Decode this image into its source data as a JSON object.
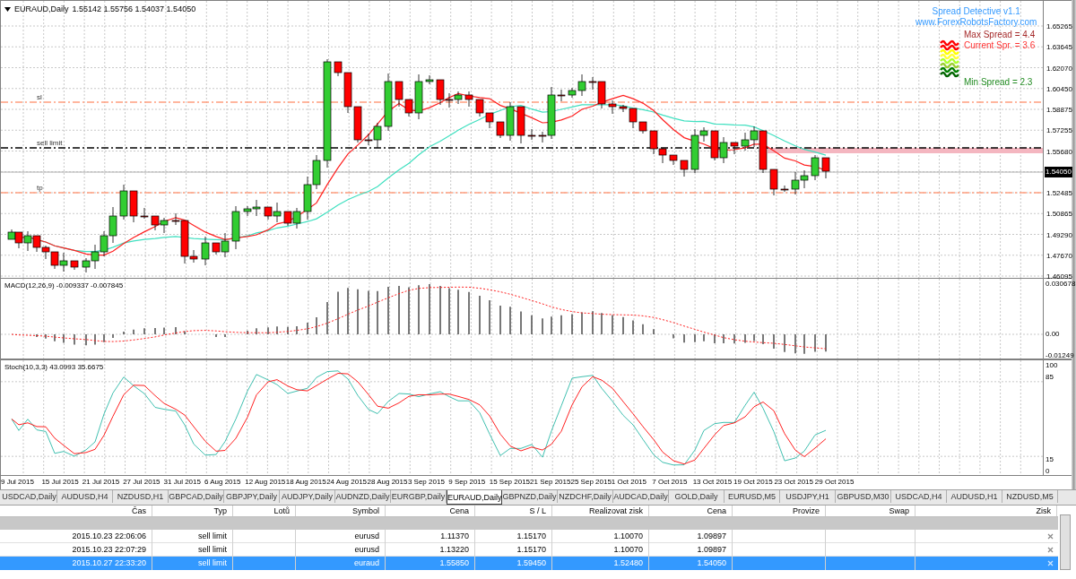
{
  "chart_header": {
    "symbol": "EURAUD,Daily",
    "ohlc": "1.55142 1.55756 1.54037 1.54050"
  },
  "order_lines": [
    {
      "kind": "sl",
      "label": "sl"
    },
    {
      "kind": "entry",
      "label": "sell limit"
    },
    {
      "kind": "tp",
      "label": "tp"
    }
  ],
  "spread_detective": {
    "title": "Spread Detective v1.1",
    "website": "www.ForexRobotsFactory.com",
    "max": "Max Spread = 4.4",
    "current": "Current Spr. = 3.6",
    "min": "Min Spread = 2.3"
  },
  "price_axis": [
    {
      "label": "1.65265",
      "kind": "tick"
    },
    {
      "label": "1.63645",
      "kind": "tick"
    },
    {
      "label": "1.62070",
      "kind": "tick"
    },
    {
      "label": "1.60450",
      "kind": "tick"
    },
    {
      "label": "1.58875",
      "kind": "tick"
    },
    {
      "label": "1.57255",
      "kind": "tick"
    },
    {
      "label": "1.55680",
      "kind": "tick"
    },
    {
      "label": "1.54050",
      "kind": "current"
    },
    {
      "label": "1.52485",
      "kind": "tick"
    },
    {
      "label": "1.50865",
      "kind": "tick"
    },
    {
      "label": "1.49290",
      "kind": "tick"
    },
    {
      "label": "1.47670",
      "kind": "tick"
    },
    {
      "label": "1.46095",
      "kind": "tick"
    }
  ],
  "macd": {
    "label": "MACD(12,26,9) -0.009337 -0.007845",
    "axis": [
      "0.030678",
      "0.00",
      "-0.01249"
    ]
  },
  "stoch": {
    "label": "Stoch(10,3,3) 43.0993 35.6675",
    "axis": [
      "100",
      "85",
      "15",
      "0"
    ]
  },
  "dates": [
    "9 Jul 2015",
    "15 Jul 2015",
    "21 Jul 2015",
    "27 Jul 2015",
    "31 Jul 2015",
    "6 Aug 2015",
    "12 Aug 2015",
    "18 Aug 2015",
    "24 Aug 2015",
    "28 Aug 2015",
    "3 Sep 2015",
    "9 Sep 2015",
    "15 Sep 2015",
    "21 Sep 2015",
    "25 Sep 2015",
    "1 Oct 2015",
    "7 Oct 2015",
    "13 Oct 2015",
    "19 Oct 2015",
    "23 Oct 2015",
    "29 Oct 2015"
  ],
  "tabs": [
    {
      "label": "USDCAD,Daily",
      "selected": false
    },
    {
      "label": "AUDUSD,H4",
      "selected": false
    },
    {
      "label": "NZDUSD,H1",
      "selected": false
    },
    {
      "label": "GBPCAD,Daily",
      "selected": false
    },
    {
      "label": "GBPJPY,Daily",
      "selected": false
    },
    {
      "label": "AUDJPY,Daily",
      "selected": false
    },
    {
      "label": "AUDNZD,Daily",
      "selected": false
    },
    {
      "label": "EURGBP,Daily",
      "selected": false
    },
    {
      "label": "EURAUD,Daily",
      "selected": true
    },
    {
      "label": "GBPNZD,Daily",
      "selected": false
    },
    {
      "label": "NZDCHF,Daily",
      "selected": false
    },
    {
      "label": "AUDCAD,Daily",
      "selected": false
    },
    {
      "label": "GOLD,Daily",
      "selected": false
    },
    {
      "label": "EURUSD,M5",
      "selected": false
    },
    {
      "label": "USDJPY,H1",
      "selected": false
    },
    {
      "label": "GBPUSD,M30",
      "selected": false
    },
    {
      "label": "USDCAD,H4",
      "selected": false
    },
    {
      "label": "AUDUSD,H1",
      "selected": false
    },
    {
      "label": "NZDUSD,M5",
      "selected": false
    }
  ],
  "table": {
    "columns": [
      "Čas",
      "Typ",
      "Lotů",
      "Symbol",
      "Cena",
      "S / L",
      "Realizovat zisk",
      "Cena",
      "Provize",
      "Swap",
      "Zisk"
    ],
    "rows": [
      {
        "time": "2015.10.23 22:06:06",
        "type": "sell limit",
        "symbol": "eurusd",
        "price": "1.11370",
        "sl": "1.15170",
        "tp": "1.10070",
        "current_price": "1.09897",
        "selected": false
      },
      {
        "time": "2015.10.23 22:07:29",
        "type": "sell limit",
        "symbol": "eurusd",
        "price": "1.13220",
        "sl": "1.15170",
        "tp": "1.10070",
        "current_price": "1.09897",
        "selected": false
      },
      {
        "time": "2015.10.27 22:33:20",
        "type": "sell limit",
        "symbol": "euraud",
        "price": "1.55850",
        "sl": "1.59450",
        "tp": "1.52480",
        "current_price": "1.54050",
        "selected": true
      }
    ]
  }
}
